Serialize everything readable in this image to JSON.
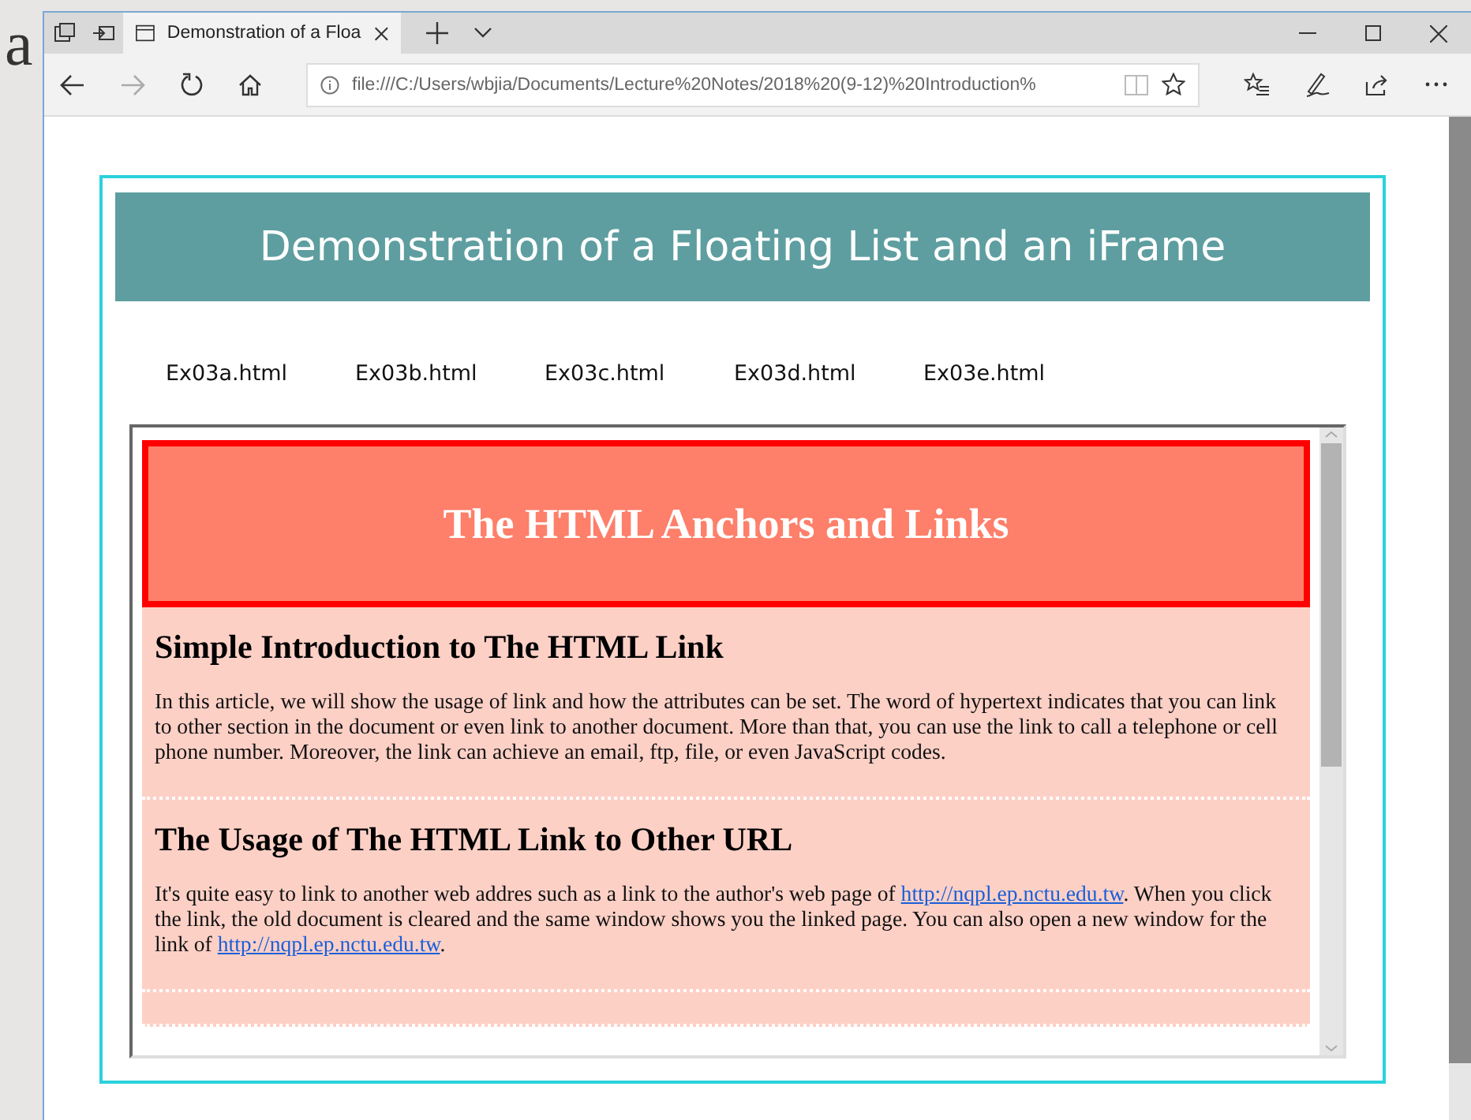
{
  "backdrop_text": "a",
  "browser": {
    "tab_title": "Demonstration of a Floa",
    "url": "file:///C:/Users/wbjia/Documents/Lecture%20Notes/2018%20(9-12)%20Introduction%"
  },
  "page": {
    "title": "Demonstration of a Floating List and an iFrame",
    "nav": [
      {
        "label": "Ex03a.html"
      },
      {
        "label": "Ex03b.html"
      },
      {
        "label": "Ex03c.html"
      },
      {
        "label": "Ex03d.html"
      },
      {
        "label": "Ex03e.html"
      }
    ],
    "iframe": {
      "heading": "The HTML Anchors and Links",
      "sections": [
        {
          "title": "Simple Introduction to The HTML Link",
          "body": [
            {
              "text": "In this article, we will show the usage of link and how the attributes can be set. The word of hypertext indicates that you can link to other section in the document or even link to another document. More than that, you can use the link to call a telephone or cell phone number. Moreover, the link can achieve an email, ftp, file, or even JavaScript codes."
            }
          ]
        },
        {
          "title": "The Usage of The HTML Link to Other URL",
          "body": [
            {
              "text": "It's quite easy to link to another web addres such as a link to the author's web page of "
            },
            {
              "link": "http://nqpl.ep.nctu.edu.tw"
            },
            {
              "text": ". When you click the link, the old document is cleared and the same window shows you the linked page. You can also open a new window for the link of "
            },
            {
              "link": "http://nqpl.ep.nctu.edu.tw"
            },
            {
              "text": "."
            }
          ]
        }
      ]
    }
  }
}
